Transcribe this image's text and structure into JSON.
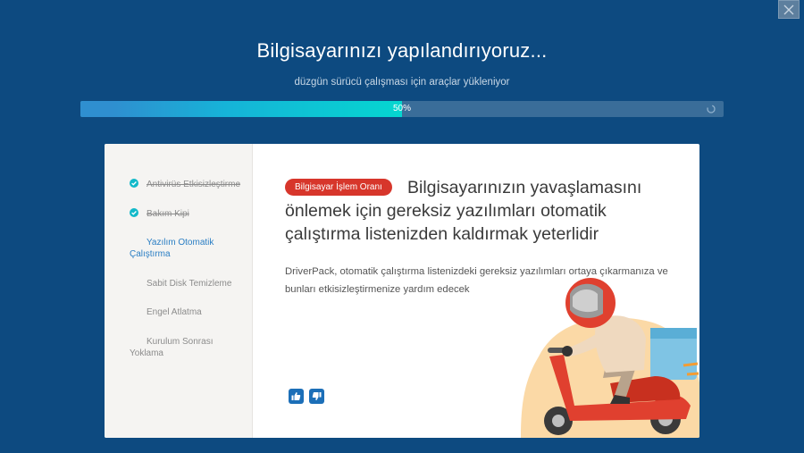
{
  "window": {
    "title": "Bilgisayarınızı yapılandırıyoruz...",
    "subtitle": "düzgün sürücü çalışması için araçlar yükleniyor",
    "close_icon": "close-icon"
  },
  "progress": {
    "percent": 50,
    "label": "50%"
  },
  "steps": [
    {
      "label": "Antivirüs Etkisizleştirme",
      "status": "done"
    },
    {
      "label": "Bakım Kipi",
      "status": "done"
    },
    {
      "label": "Yazılım Otomatik Çalıştırma",
      "status": "active"
    },
    {
      "label": "Sabit Disk Temizleme",
      "status": "pending"
    },
    {
      "label": "Engel Atlatma",
      "status": "pending"
    },
    {
      "label": "Kurulum Sonrası Yoklama",
      "status": "pending"
    }
  ],
  "article": {
    "badge": "Bilgisayar İşlem Oranı",
    "headline": "Bilgisayarınızın yavaşlamasını önlemek için gereksiz yazılımları otomatik çalıştırma listenizden kaldırmak yeterlidir",
    "description": "DriverPack, otomatik çalıştırma listenizdeki gereksiz yazılımları ortaya çıkarmanıza ve bunları etkisizleştirmenize yardım edecek"
  },
  "feedback": {
    "like_icon": "thumbs-up-icon",
    "dislike_icon": "thumbs-down-icon"
  },
  "colors": {
    "background": "#0d4a80",
    "accent": "#05d6d0",
    "badge": "#d7362b",
    "active_step": "#2a7ec4"
  }
}
